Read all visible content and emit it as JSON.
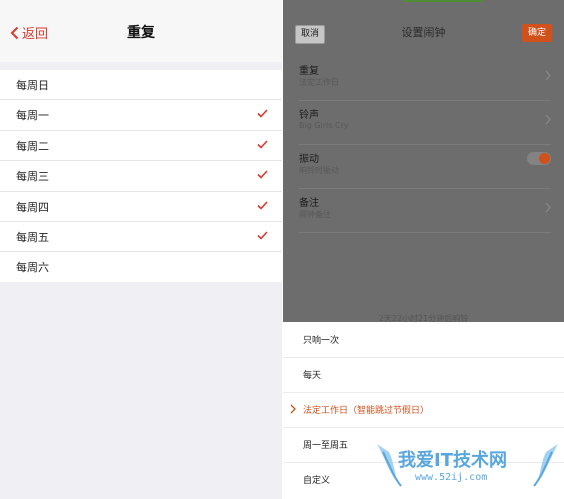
{
  "left": {
    "back_label": "返回",
    "title": "重复",
    "days": [
      {
        "label": "每周日",
        "checked": false
      },
      {
        "label": "每周一",
        "checked": true
      },
      {
        "label": "每周二",
        "checked": true
      },
      {
        "label": "每周三",
        "checked": true
      },
      {
        "label": "每周四",
        "checked": true
      },
      {
        "label": "每周五",
        "checked": true
      },
      {
        "label": "每周六",
        "checked": false
      }
    ]
  },
  "right": {
    "cancel_label": "取消",
    "title": "设置闹钟",
    "confirm_label": "确定",
    "settings": {
      "repeat": {
        "label": "重复",
        "value": "法定工作日"
      },
      "ringtone": {
        "label": "铃声",
        "value": "Big Girls Cry"
      },
      "vibrate": {
        "label": "振动",
        "value": "响铃时振动",
        "enabled": true
      },
      "note": {
        "label": "备注",
        "value": "闹钟备注"
      }
    },
    "countdown": "2天22小时21分钟后响铃",
    "options": [
      {
        "label": "只响一次",
        "selected": false
      },
      {
        "label": "每天",
        "selected": false
      },
      {
        "label": "法定工作日（智能跳过节假日）",
        "selected": true
      },
      {
        "label": "周一至周五",
        "selected": false
      },
      {
        "label": "自定义",
        "selected": false
      }
    ]
  },
  "watermark": {
    "text": "我爱IT技术网",
    "url": "www.52ij.com"
  },
  "colors": {
    "accent_red": "#d8392f",
    "accent_orange": "#d0511b",
    "overlay": "#6d6d6d"
  }
}
